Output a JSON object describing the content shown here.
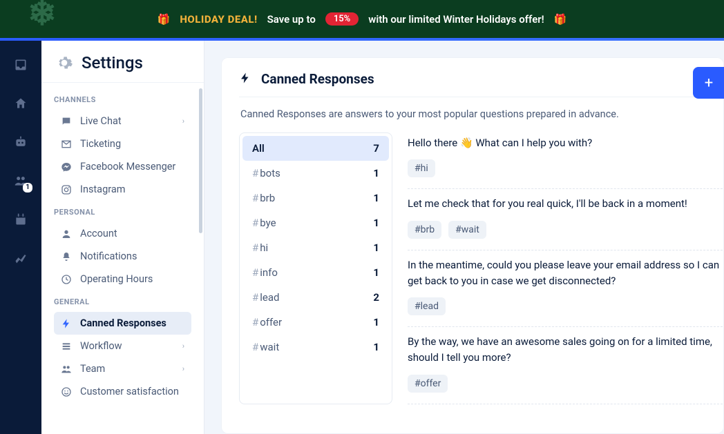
{
  "banner": {
    "deal": "HOLIDAY DEAL!",
    "pre": "Save up to",
    "pill": "15%",
    "post": "with our limited Winter Holidays offer!",
    "gift": "🎁"
  },
  "rail": {
    "badge": "1"
  },
  "panel": {
    "title": "Settings",
    "sections": [
      {
        "heading": "CHANNELS",
        "items": [
          {
            "label": "Live Chat",
            "icon": "chat",
            "chev": true
          },
          {
            "label": "Ticketing",
            "icon": "mail"
          },
          {
            "label": "Facebook Messenger",
            "icon": "messenger"
          },
          {
            "label": "Instagram",
            "icon": "instagram"
          }
        ]
      },
      {
        "heading": "PERSONAL",
        "items": [
          {
            "label": "Account",
            "icon": "user"
          },
          {
            "label": "Notifications",
            "icon": "bell"
          },
          {
            "label": "Operating Hours",
            "icon": "clock"
          }
        ]
      },
      {
        "heading": "GENERAL",
        "items": [
          {
            "label": "Canned Responses",
            "icon": "bolt",
            "active": true
          },
          {
            "label": "Workflow",
            "icon": "list",
            "chev": true
          },
          {
            "label": "Team",
            "icon": "team",
            "chev": true
          },
          {
            "label": "Customer satisfaction",
            "icon": "smile"
          }
        ]
      }
    ]
  },
  "main": {
    "title": "Canned Responses",
    "desc": "Canned Responses are answers to your most popular questions prepared in advance.",
    "tags": [
      {
        "label": "All",
        "count": "7",
        "active": true,
        "nohash": true
      },
      {
        "label": "bots",
        "count": "1"
      },
      {
        "label": "brb",
        "count": "1"
      },
      {
        "label": "bye",
        "count": "1"
      },
      {
        "label": "hi",
        "count": "1"
      },
      {
        "label": "info",
        "count": "1"
      },
      {
        "label": "lead",
        "count": "2"
      },
      {
        "label": "offer",
        "count": "1"
      },
      {
        "label": "wait",
        "count": "1"
      }
    ],
    "responses": [
      {
        "text": "Hello there  👋  What can I help you with?",
        "chips": [
          "#hi"
        ]
      },
      {
        "text": "Let me check that for you real quick, I'll be back in a moment!",
        "chips": [
          "#brb",
          "#wait"
        ]
      },
      {
        "text": "In the meantime, could you please leave your email address so I can get back to you in case we get disconnected?",
        "chips": [
          "#lead"
        ]
      },
      {
        "text": "By the way, we have an awesome sales going on for a limited time, should I tell you more?",
        "chips": [
          "#offer"
        ]
      }
    ]
  }
}
